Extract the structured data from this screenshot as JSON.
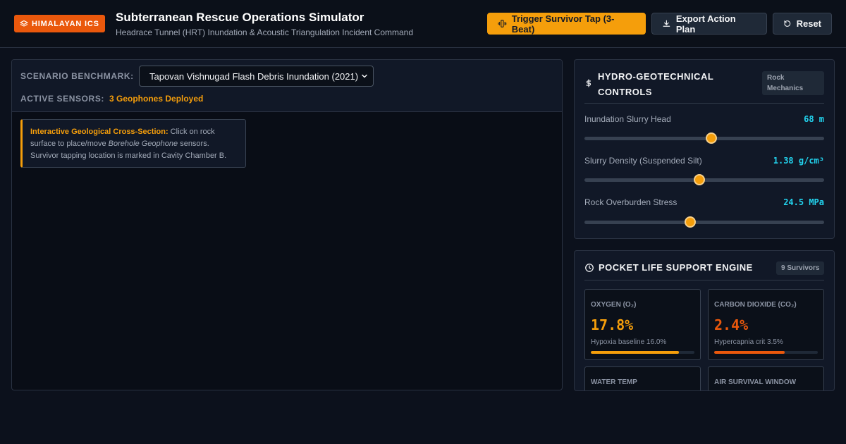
{
  "header": {
    "brand": "HIMALAYAN ICS",
    "title": "Subterranean Rescue Operations Simulator",
    "subtitle": "Headrace Tunnel (HRT) Inundation & Acoustic Triangulation Incident Command",
    "buttons": {
      "trigger": "Trigger Survivor Tap (3-Beat)",
      "export": "Export Action Plan",
      "reset": "Reset"
    }
  },
  "scenario": {
    "label": "SCENARIO BENCHMARK:",
    "selected": "Tapovan Vishnugad Flash Debris Inundation (2021)",
    "sensors_label": "ACTIVE SENSORS:",
    "sensors_value": "3 Geophones Deployed"
  },
  "info": {
    "heading": "Interactive Geological Cross-Section:",
    "text_a": " Click on rock surface to place/move ",
    "text_em": "Borehole Geophone",
    "text_b": " sensors. Survivor tapping location is marked in Cavity Chamber B."
  },
  "hydro": {
    "title_line1": "HYDRO-GEOTECHNICAL",
    "title_line2": "CONTROLS",
    "tag_line1": "Rock",
    "tag_line2": "Mechanics",
    "sliders": [
      {
        "label": "Inundation Slurry Head",
        "value": "68 m",
        "position": 0.53
      },
      {
        "label": "Slurry Density (Suspended Silt)",
        "value": "1.38 g/cm³",
        "position": 0.48
      },
      {
        "label": "Rock Overburden Stress",
        "value": "24.5 MPa",
        "position": 0.44
      }
    ]
  },
  "life": {
    "title": "POCKET LIFE SUPPORT ENGINE",
    "tag": "9 Survivors",
    "metrics": [
      {
        "label": "OXYGEN (O₂)",
        "value": "17.8%",
        "note": "Hypoxia baseline 16.0%",
        "level": 0.85,
        "color": "#f59e0b"
      },
      {
        "label": "CARBON DIOXIDE (CO₂)",
        "value": "2.4%",
        "note": "Hypercapnia crit 3.5%",
        "level": 0.68,
        "color": "#ea580c"
      },
      {
        "label": "WATER TEMP",
        "value": "",
        "note": "",
        "level": 0,
        "color": "#22d3ee"
      },
      {
        "label": "AIR SURVIVAL WINDOW",
        "value": "",
        "note": "",
        "level": 0,
        "color": "#22d3ee"
      }
    ]
  }
}
